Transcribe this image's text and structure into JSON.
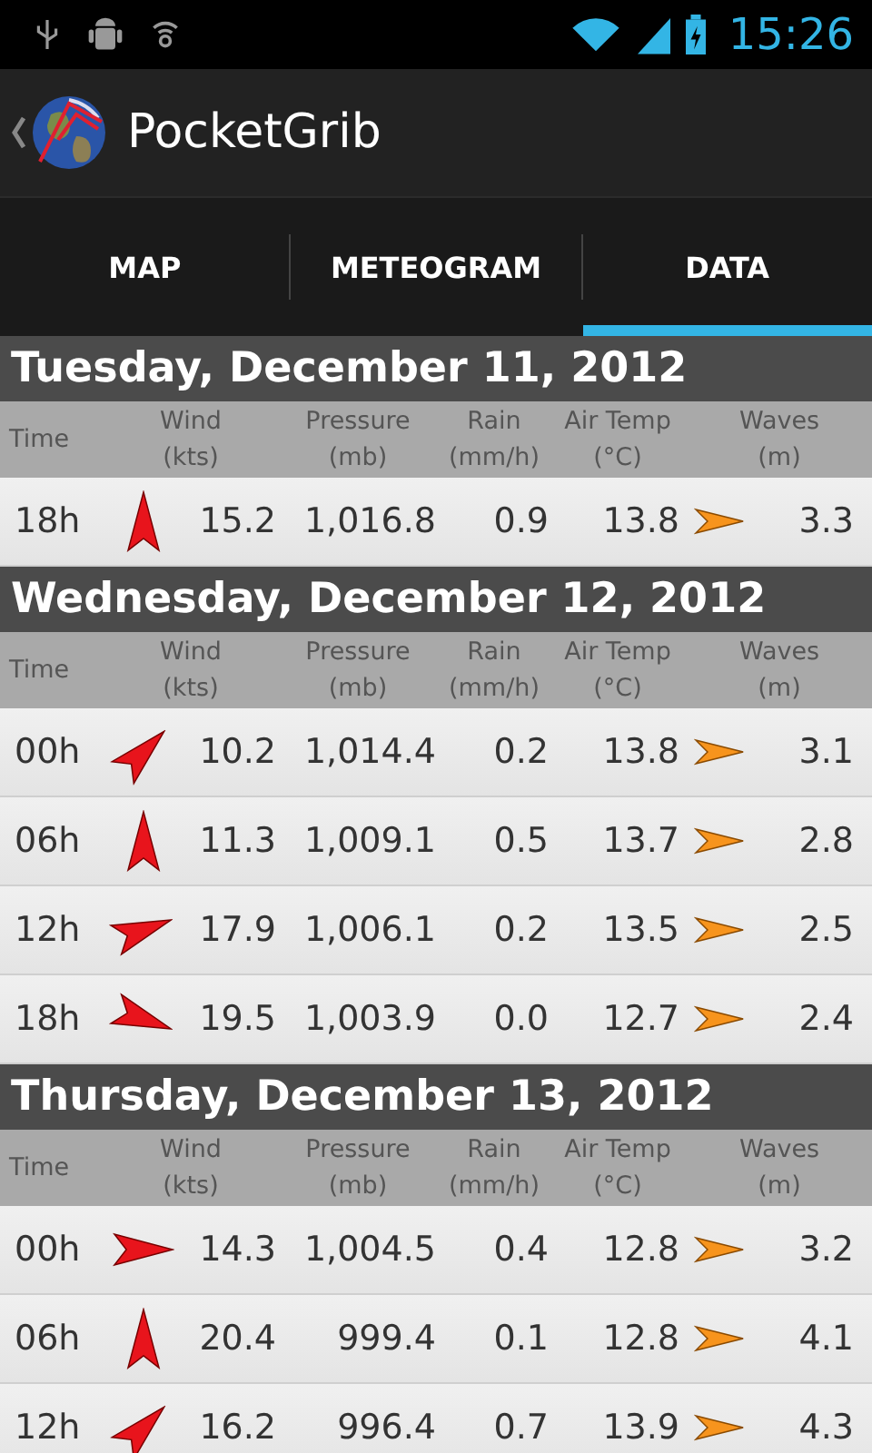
{
  "status_bar": {
    "time": "15:26"
  },
  "action_bar": {
    "title": "PocketGrib"
  },
  "tabs": [
    {
      "label": "MAP",
      "selected": false
    },
    {
      "label": "METEOGRAM",
      "selected": false
    },
    {
      "label": "DATA",
      "selected": true
    }
  ],
  "days": [
    {
      "date": "Tuesday, December 11, 2012",
      "columns": [
        {
          "label": "Time"
        },
        {
          "label": "Wind",
          "unit": "(kts)"
        },
        {
          "label": "Pressure",
          "unit": "(mb)"
        },
        {
          "label": "Rain",
          "unit": "(mm/h)"
        },
        {
          "label": "Air Temp",
          "unit": "(°C)"
        },
        {
          "label": "Waves",
          "unit": "(m)"
        }
      ],
      "rows": [
        {
          "time": "18h",
          "wind": "15.2",
          "pressure": "1,016.8",
          "rain": "0.9",
          "air_temp": "13.8",
          "waves": "3.3"
        }
      ]
    },
    {
      "date": "Wednesday, December 12, 2012",
      "columns": [
        {
          "label": "Time"
        },
        {
          "label": "Wind",
          "unit": "(kts)"
        },
        {
          "label": "Pressure",
          "unit": "(mb)"
        },
        {
          "label": "Rain",
          "unit": "(mm/h)"
        },
        {
          "label": "Air Temp",
          "unit": "(°C)"
        },
        {
          "label": "Waves",
          "unit": "(m)"
        }
      ],
      "rows": [
        {
          "time": "00h",
          "wind": "10.2",
          "pressure": "1,014.4",
          "rain": "0.2",
          "air_temp": "13.8",
          "waves": "3.1"
        },
        {
          "time": "06h",
          "wind": "11.3",
          "pressure": "1,009.1",
          "rain": "0.5",
          "air_temp": "13.7",
          "waves": "2.8"
        },
        {
          "time": "12h",
          "wind": "17.9",
          "pressure": "1,006.1",
          "rain": "0.2",
          "air_temp": "13.5",
          "waves": "2.5"
        },
        {
          "time": "18h",
          "wind": "19.5",
          "pressure": "1,003.9",
          "rain": "0.0",
          "air_temp": "12.7",
          "waves": "2.4"
        }
      ]
    },
    {
      "date": "Thursday, December 13, 2012",
      "columns": [
        {
          "label": "Time"
        },
        {
          "label": "Wind",
          "unit": "(kts)"
        },
        {
          "label": "Pressure",
          "unit": "(mb)"
        },
        {
          "label": "Rain",
          "unit": "(mm/h)"
        },
        {
          "label": "Air Temp",
          "unit": "(°C)"
        },
        {
          "label": "Waves",
          "unit": "(m)"
        }
      ],
      "rows": [
        {
          "time": "00h",
          "wind": "14.3",
          "pressure": "1,004.5",
          "rain": "0.4",
          "air_temp": "12.8",
          "waves": "3.2"
        },
        {
          "time": "06h",
          "wind": "20.4",
          "pressure": "999.4",
          "rain": "0.1",
          "air_temp": "12.8",
          "waves": "4.1"
        },
        {
          "time": "12h",
          "wind": "16.2",
          "pressure": "996.4",
          "rain": "0.7",
          "air_temp": "13.9",
          "waves": "4.3"
        }
      ]
    }
  ]
}
